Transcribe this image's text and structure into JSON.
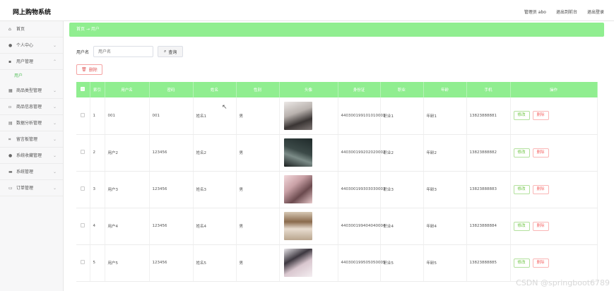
{
  "header": {
    "title": "网上购物系统",
    "user_label": "管理员 abo",
    "front_link": "退出到前台",
    "logout_link": "退出登录"
  },
  "sidebar": {
    "items": [
      {
        "label": "首页",
        "icon": "home-icon"
      },
      {
        "label": "个人中心",
        "icon": "user-icon"
      },
      {
        "label": "用户管理",
        "icon": "users-icon"
      },
      {
        "label": "商品类型管理",
        "icon": "list-icon"
      },
      {
        "label": "商品信息管理",
        "icon": "box-icon"
      },
      {
        "label": "数据分析管理",
        "icon": "chart-icon"
      },
      {
        "label": "留言板管理",
        "icon": "message-icon"
      },
      {
        "label": "系统收藏管理",
        "icon": "star-icon"
      },
      {
        "label": "系统管理",
        "icon": "settings-icon"
      },
      {
        "label": "订单管理",
        "icon": "order-icon"
      }
    ],
    "sub_item": "用户"
  },
  "breadcrumb": {
    "home": "首页",
    "sep": "→",
    "current": "用户"
  },
  "search": {
    "label": "用户名",
    "placeholder": "用户名",
    "button": "查询"
  },
  "batch_delete": "删除",
  "table": {
    "headers": [
      "",
      "索引",
      "用户名",
      "密码",
      "姓名",
      "性别",
      "头像",
      "身份证",
      "职业",
      "年龄",
      "手机",
      "操作"
    ],
    "rows": [
      {
        "index": "1",
        "username": "001",
        "password": "001",
        "name": "姓名1",
        "gender": "男",
        "idcard": "440300199101010001",
        "job": "职业1",
        "age": "年龄1",
        "phone": "13823888881"
      },
      {
        "index": "2",
        "username": "用户2",
        "password": "123456",
        "name": "姓名2",
        "gender": "男",
        "idcard": "440300199202020002",
        "job": "职业2",
        "age": "年龄2",
        "phone": "13823888882"
      },
      {
        "index": "3",
        "username": "用户3",
        "password": "123456",
        "name": "姓名3",
        "gender": "男",
        "idcard": "440300199303030003",
        "job": "职业3",
        "age": "年龄3",
        "phone": "13823888883"
      },
      {
        "index": "4",
        "username": "用户4",
        "password": "123456",
        "name": "姓名4",
        "gender": "男",
        "idcard": "440300199404040004",
        "job": "职业4",
        "age": "年龄4",
        "phone": "13823888884"
      },
      {
        "index": "5",
        "username": "用户5",
        "password": "123456",
        "name": "姓名5",
        "gender": "男",
        "idcard": "440300199505050005",
        "job": "职业5",
        "age": "年龄5",
        "phone": "13823888885"
      }
    ],
    "edit_label": "修改",
    "delete_label": "删除"
  },
  "watermark": "CSDN @springboot6789",
  "colors": {
    "accent": "#90ee90",
    "active": "#58c15d",
    "danger": "#f56c6c",
    "success": "#67c23a"
  }
}
